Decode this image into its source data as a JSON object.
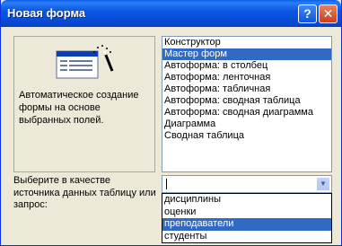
{
  "window": {
    "title": "Новая форма",
    "help_glyph": "?",
    "close_glyph": "✕"
  },
  "preview": {
    "description": "Автоматическое создание формы на основе выбранных полей."
  },
  "form_types": {
    "items": [
      "Конструктор",
      "Мастер форм",
      "Автоформа: в столбец",
      "Автоформа: ленточная",
      "Автоформа: табличная",
      "Автоформа:  сводная таблица",
      "Автоформа:  сводная диаграмма",
      "Диаграмма",
      "Сводная таблица"
    ],
    "selected_index": 1
  },
  "source": {
    "label": "Выберите в качестве источника данных таблицу или запрос:",
    "value": "",
    "dropdown_arrow": "▼",
    "options": [
      "дисциплины",
      "оценки",
      "преподаватели",
      "студенты"
    ],
    "selected_index": 2
  },
  "colors": {
    "title_bar": "#0b58e3",
    "selection": "#316ac5",
    "dialog_bg": "#ece9d8"
  }
}
